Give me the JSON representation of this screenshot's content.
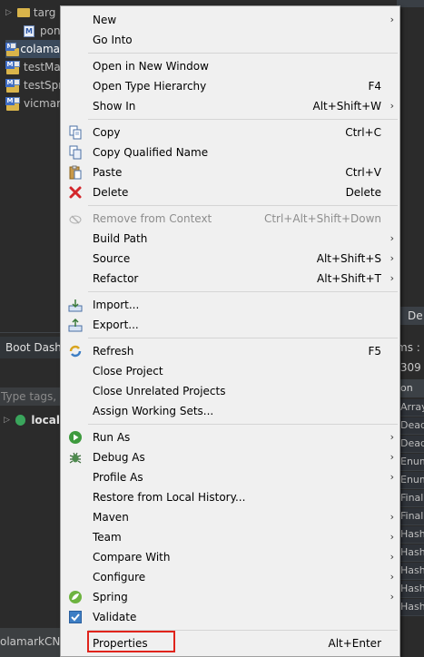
{
  "tree": {
    "items": [
      {
        "label": "targ",
        "icon": "folder-icon"
      },
      {
        "label": "pon",
        "icon": "pom-file-icon"
      },
      {
        "label": "colama",
        "icon": "maven-project-icon"
      },
      {
        "label": "testMa",
        "icon": "maven-project-icon"
      },
      {
        "label": "testSpr",
        "icon": "maven-project-icon"
      },
      {
        "label": "vicmar",
        "icon": "maven-project-icon"
      }
    ]
  },
  "boot_dashboard": {
    "title": "Boot Dash",
    "filter_placeholder": "Type tags, p",
    "local_label": "local"
  },
  "status_bar": {
    "text": "olamarkCN"
  },
  "right_panel": {
    "tab_label": "De",
    "header_text": "ms :",
    "sub_text": ",309",
    "col_header": "on",
    "rows": [
      "Array",
      "Dead",
      "Dead",
      "Enum",
      "Enum",
      "Finall",
      "Finall",
      "Hash",
      "Hash",
      "Hash",
      "Hash",
      "Hash"
    ]
  },
  "context_menu": {
    "items": [
      {
        "label": "New",
        "accel": "",
        "submenu": true,
        "icon": ""
      },
      {
        "label": "Go Into",
        "accel": "",
        "submenu": false,
        "icon": ""
      },
      {
        "label": "Open in New Window",
        "accel": "",
        "submenu": false,
        "icon": ""
      },
      {
        "label": "Open Type Hierarchy",
        "accel": "F4",
        "submenu": false,
        "icon": ""
      },
      {
        "label": "Show In",
        "accel": "Alt+Shift+W",
        "submenu": true,
        "icon": ""
      },
      {
        "label": "Copy",
        "accel": "Ctrl+C",
        "submenu": false,
        "icon": "copy-icon"
      },
      {
        "label": "Copy Qualified Name",
        "accel": "",
        "submenu": false,
        "icon": "copy-qualified-name-icon"
      },
      {
        "label": "Paste",
        "accel": "Ctrl+V",
        "submenu": false,
        "icon": "paste-icon"
      },
      {
        "label": "Delete",
        "accel": "Delete",
        "submenu": false,
        "icon": "delete-icon"
      },
      {
        "label": "Remove from Context",
        "accel": "Ctrl+Alt+Shift+Down",
        "submenu": false,
        "icon": "remove-context-icon",
        "disabled": true
      },
      {
        "label": "Build Path",
        "accel": "",
        "submenu": true,
        "icon": ""
      },
      {
        "label": "Source",
        "accel": "Alt+Shift+S",
        "submenu": true,
        "icon": ""
      },
      {
        "label": "Refactor",
        "accel": "Alt+Shift+T",
        "submenu": true,
        "icon": ""
      },
      {
        "label": "Import...",
        "accel": "",
        "submenu": false,
        "icon": "import-icon"
      },
      {
        "label": "Export...",
        "accel": "",
        "submenu": false,
        "icon": "export-icon"
      },
      {
        "label": "Refresh",
        "accel": "F5",
        "submenu": false,
        "icon": "refresh-icon"
      },
      {
        "label": "Close Project",
        "accel": "",
        "submenu": false,
        "icon": ""
      },
      {
        "label": "Close Unrelated Projects",
        "accel": "",
        "submenu": false,
        "icon": ""
      },
      {
        "label": "Assign Working Sets...",
        "accel": "",
        "submenu": false,
        "icon": ""
      },
      {
        "label": "Run As",
        "accel": "",
        "submenu": true,
        "icon": "run-icon"
      },
      {
        "label": "Debug As",
        "accel": "",
        "submenu": true,
        "icon": "debug-icon"
      },
      {
        "label": "Profile As",
        "accel": "",
        "submenu": true,
        "icon": ""
      },
      {
        "label": "Restore from Local History...",
        "accel": "",
        "submenu": false,
        "icon": ""
      },
      {
        "label": "Maven",
        "accel": "",
        "submenu": true,
        "icon": ""
      },
      {
        "label": "Team",
        "accel": "",
        "submenu": true,
        "icon": ""
      },
      {
        "label": "Compare With",
        "accel": "",
        "submenu": true,
        "icon": ""
      },
      {
        "label": "Configure",
        "accel": "",
        "submenu": true,
        "icon": ""
      },
      {
        "label": "Spring",
        "accel": "",
        "submenu": true,
        "icon": "spring-icon"
      },
      {
        "label": "Validate",
        "accel": "",
        "submenu": false,
        "icon": "validate-checkbox-icon"
      },
      {
        "label": "Properties",
        "accel": "Alt+Enter",
        "submenu": false,
        "icon": ""
      }
    ],
    "highlighted_item": "Properties",
    "highlight_color": "#e0241c"
  }
}
